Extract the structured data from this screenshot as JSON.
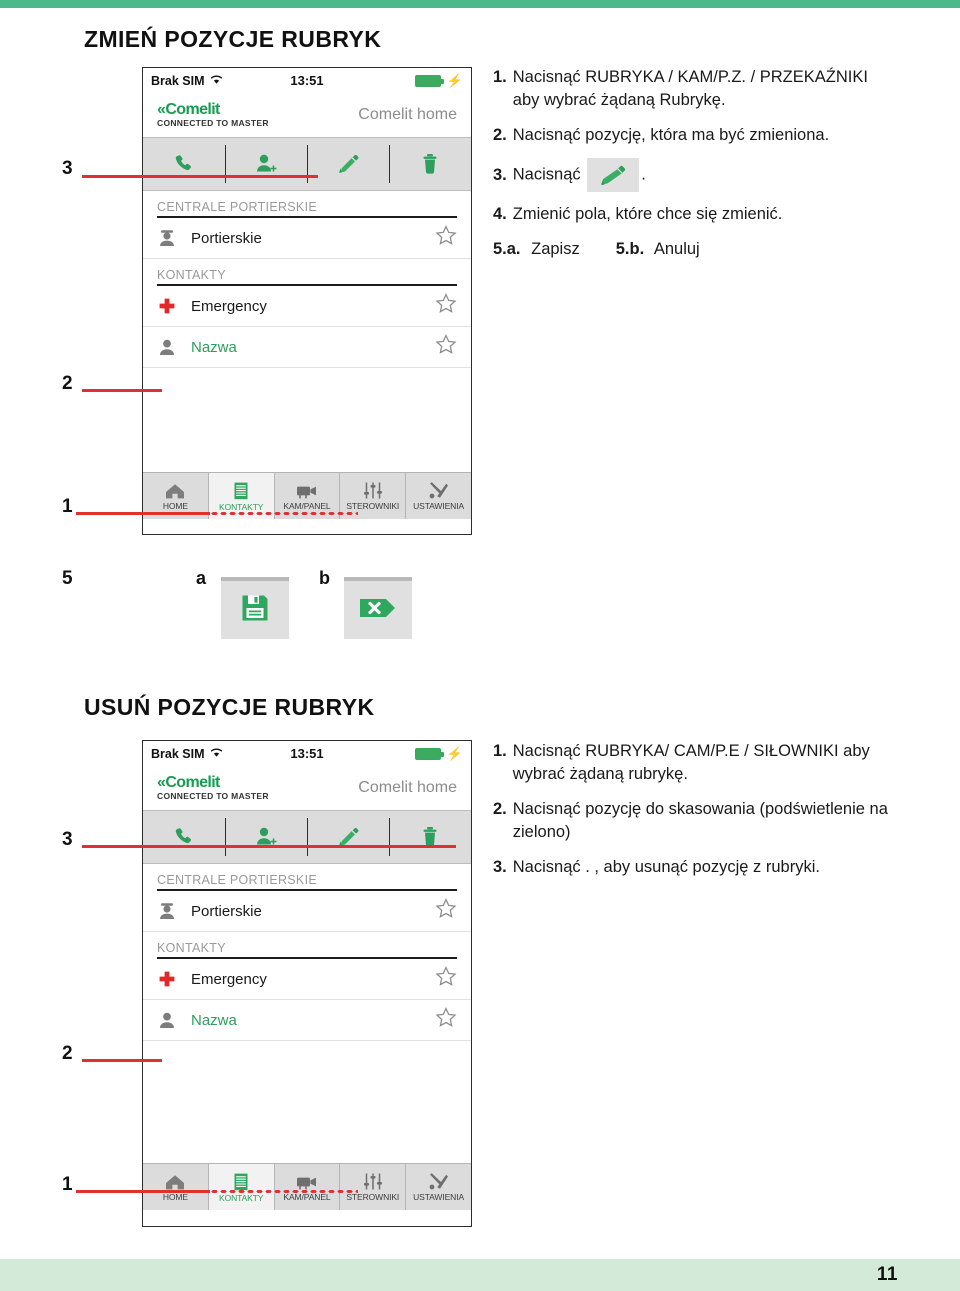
{
  "page": {
    "number": "11",
    "accent_green": "#4cb98a",
    "callout_red": "#e03030",
    "brand_green": "#179c52"
  },
  "sections": [
    {
      "title": "ZMIEŃ POZYCJE RUBRYK",
      "instructions": [
        {
          "num": "1.",
          "text": "Nacisnąć RUBRYKA / KAM/P.Z. / PRZEKAŹNIKI aby wybrać żądaną Rubrykę."
        },
        {
          "num": "2.",
          "text": "Nacisnąć pozycję, która ma być zmieniona."
        },
        {
          "num": "3.",
          "text_before": "Nacisnąć",
          "icon": "pencil-icon",
          "text_after": "."
        },
        {
          "num": "4.",
          "text": "Zmienić pola, które chce się zmienić."
        },
        {
          "num": "5.a.",
          "text": "Zapisz",
          "num2": "5.b.",
          "text2": "Anuluj"
        }
      ],
      "callouts": [
        {
          "label": "3"
        },
        {
          "label": "2"
        },
        {
          "label": "1"
        },
        {
          "label": "5"
        }
      ],
      "buttons": [
        {
          "letter": "a",
          "icon": "save-floppy-icon",
          "name": "save-button"
        },
        {
          "letter": "b",
          "icon": "cancel-arrow-x-icon",
          "name": "cancel-button"
        }
      ]
    },
    {
      "title": "USUŃ POZYCJE RUBRYK",
      "instructions": [
        {
          "num": "1.",
          "text": "Nacisnąć RUBRYKA/ CAM/P.E / SIŁOWNIKI aby wybrać żądaną rubrykę."
        },
        {
          "num": "2.",
          "text": "Nacisnąć pozycję do skasowania (podświetlenie na zielono)"
        },
        {
          "num": "3.",
          "text": "Nacisnąć . , aby usunąć pozycję z rubryki."
        }
      ],
      "callouts": [
        {
          "label": "3"
        },
        {
          "label": "2"
        },
        {
          "label": "1"
        }
      ]
    }
  ],
  "phone": {
    "statusbar": {
      "carrier": "Brak SIM",
      "wifi_icon": "wifi-icon",
      "time": "13:51",
      "battery_icon": "battery-charging-icon"
    },
    "brandbar": {
      "logo": "Comelit",
      "logo_chevron": "«",
      "subtitle": "CONNECTED TO MASTER",
      "right_title": "Comelit home"
    },
    "toolbar": [
      {
        "name": "call-icon",
        "label": "call"
      },
      {
        "name": "add-contact-icon",
        "label": "add contact"
      },
      {
        "name": "pencil-icon",
        "label": "edit"
      },
      {
        "name": "trash-icon",
        "label": "delete"
      }
    ],
    "groups": [
      {
        "header": "CENTRALE PORTIERSKIE",
        "rows": [
          {
            "icon": "concierge-icon",
            "label": "Portierskie",
            "highlight": false,
            "star": "star-outline-icon"
          }
        ]
      },
      {
        "header": "KONTAKTY",
        "rows": [
          {
            "icon": "red-cross-icon",
            "label": "Emergency",
            "highlight": false,
            "star": "star-outline-icon"
          },
          {
            "icon": "person-icon",
            "label": "Nazwa",
            "highlight": true,
            "star": "star-outline-icon"
          }
        ]
      }
    ],
    "navbar": [
      {
        "icon": "home-icon",
        "label": "HOME",
        "active": false
      },
      {
        "icon": "contacts-list-icon",
        "label": "KONTAKTY",
        "active": true
      },
      {
        "icon": "camera-icon",
        "label": "KAM/PANEL",
        "active": false
      },
      {
        "icon": "sliders-icon",
        "label": "STEROWNIKI",
        "active": false
      },
      {
        "icon": "tools-icon",
        "label": "USTAWIENIA",
        "active": false
      }
    ]
  }
}
